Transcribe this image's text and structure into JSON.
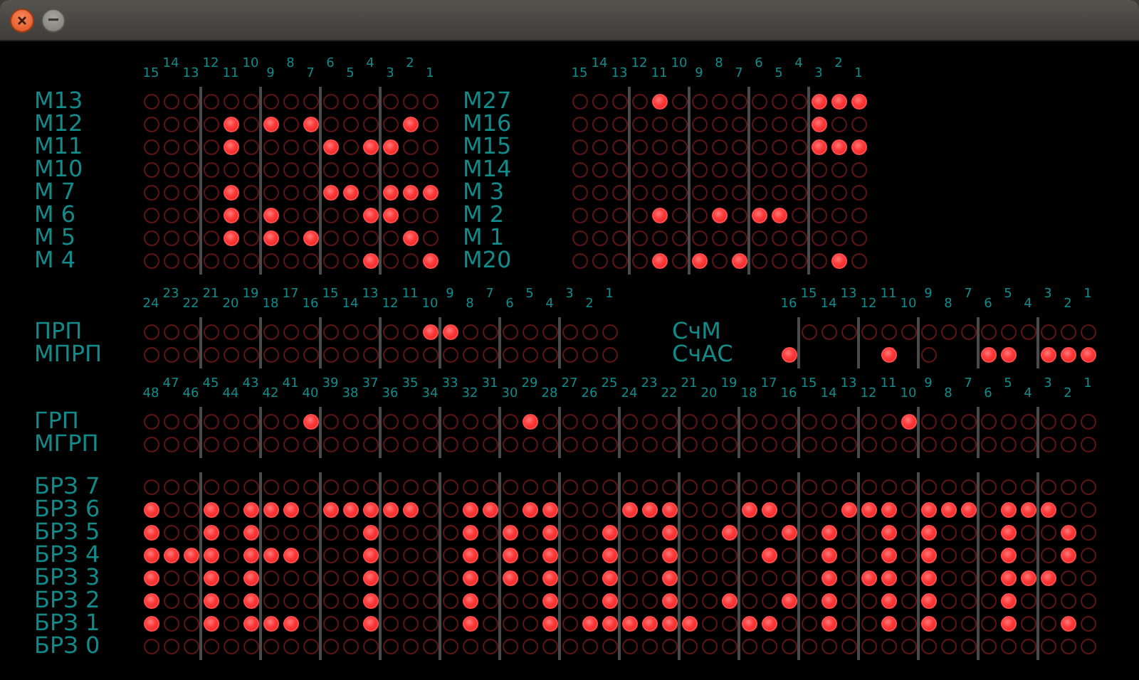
{
  "window": {
    "controls": [
      {
        "kind": "close"
      },
      {
        "kind": "minimize"
      }
    ]
  },
  "sections": [
    {
      "blocks": [
        {
          "numbers": [
            "15",
            "14",
            "13",
            "12",
            "11",
            "10",
            "9",
            "8",
            "7",
            "6",
            "5",
            "4",
            "3",
            "2",
            "1"
          ],
          "rows": [
            {
              "label": "М13",
              "lamps": [
                false,
                false,
                false,
                false,
                false,
                false,
                false,
                false,
                false,
                false,
                false,
                false,
                false,
                false,
                false
              ]
            },
            {
              "label": "М12",
              "lamps": [
                false,
                false,
                false,
                false,
                true,
                false,
                true,
                false,
                true,
                false,
                false,
                false,
                false,
                true,
                false
              ]
            },
            {
              "label": "М11",
              "lamps": [
                false,
                false,
                false,
                false,
                true,
                false,
                false,
                false,
                false,
                true,
                false,
                true,
                true,
                false,
                false
              ]
            },
            {
              "label": "М10",
              "lamps": [
                false,
                false,
                false,
                false,
                false,
                false,
                false,
                false,
                false,
                false,
                false,
                false,
                false,
                false,
                false
              ]
            },
            {
              "label": "М 7",
              "lamps": [
                false,
                false,
                false,
                false,
                true,
                false,
                false,
                false,
                false,
                true,
                true,
                false,
                true,
                true,
                true
              ]
            },
            {
              "label": "М 6",
              "lamps": [
                false,
                false,
                false,
                false,
                true,
                false,
                true,
                false,
                false,
                false,
                false,
                true,
                true,
                false,
                false
              ]
            },
            {
              "label": "М 5",
              "lamps": [
                false,
                false,
                false,
                false,
                true,
                false,
                true,
                false,
                true,
                false,
                false,
                false,
                false,
                true,
                false
              ]
            },
            {
              "label": "М 4",
              "lamps": [
                false,
                false,
                false,
                false,
                false,
                false,
                false,
                false,
                false,
                false,
                false,
                true,
                false,
                false,
                true
              ]
            }
          ]
        },
        {
          "numbers": [
            "15",
            "14",
            "13",
            "12",
            "11",
            "10",
            "9",
            "8",
            "7",
            "6",
            "5",
            "4",
            "3",
            "2",
            "1"
          ],
          "rows": [
            {
              "label": "М27",
              "lamps": [
                false,
                false,
                false,
                false,
                true,
                false,
                false,
                false,
                false,
                false,
                false,
                false,
                true,
                true,
                true
              ]
            },
            {
              "label": "М16",
              "lamps": [
                false,
                false,
                false,
                false,
                false,
                false,
                false,
                false,
                false,
                false,
                false,
                false,
                true,
                false,
                false
              ]
            },
            {
              "label": "М15",
              "lamps": [
                false,
                false,
                false,
                false,
                false,
                false,
                false,
                false,
                false,
                false,
                false,
                false,
                true,
                true,
                true
              ]
            },
            {
              "label": "М14",
              "lamps": [
                false,
                false,
                false,
                false,
                false,
                false,
                false,
                false,
                false,
                false,
                false,
                false,
                false,
                false,
                false
              ]
            },
            {
              "label": "М 3",
              "lamps": [
                false,
                false,
                false,
                false,
                false,
                false,
                false,
                false,
                false,
                false,
                false,
                false,
                false,
                false,
                false
              ]
            },
            {
              "label": "М 2",
              "lamps": [
                false,
                false,
                false,
                false,
                true,
                false,
                false,
                true,
                false,
                true,
                true,
                false,
                false,
                false,
                false
              ]
            },
            {
              "label": "М 1",
              "lamps": [
                false,
                false,
                false,
                false,
                false,
                false,
                false,
                false,
                false,
                false,
                false,
                false,
                false,
                false,
                false
              ]
            },
            {
              "label": "М20",
              "lamps": [
                false,
                false,
                false,
                false,
                true,
                false,
                true,
                false,
                true,
                false,
                false,
                false,
                false,
                true,
                false
              ]
            }
          ]
        }
      ]
    },
    {
      "blocks": [
        {
          "numbers": [
            "24",
            "23",
            "22",
            "21",
            "20",
            "19",
            "18",
            "17",
            "16",
            "15",
            "14",
            "13",
            "12",
            "11",
            "10",
            "9",
            "8",
            "7",
            "6",
            "5",
            "4",
            "3",
            "2",
            "1"
          ],
          "rows": [
            {
              "label": "ПРП",
              "lamps": [
                false,
                false,
                false,
                false,
                false,
                false,
                false,
                false,
                false,
                false,
                false,
                false,
                false,
                false,
                true,
                true,
                false,
                false,
                false,
                false,
                false,
                false,
                false,
                false
              ]
            },
            {
              "label": "МПРП",
              "lamps": [
                false,
                false,
                false,
                false,
                false,
                false,
                false,
                false,
                false,
                false,
                false,
                false,
                false,
                false,
                false,
                false,
                false,
                false,
                false,
                false,
                false,
                false,
                false,
                false
              ]
            }
          ]
        },
        {
          "numbers": [
            "16",
            "15",
            "14",
            "13",
            "12",
            "11",
            "10",
            "9",
            "8",
            "7",
            "6",
            "5",
            "4",
            "3",
            "2",
            "1"
          ],
          "rows": [
            {
              "label": "СчМ",
              "lamps": [
                {
                  "kind": "gap"
                },
                {
                  "kind": "lamp",
                  "on": false
                },
                {
                  "kind": "lamp",
                  "on": false
                },
                {
                  "kind": "lamp",
                  "on": false
                },
                {
                  "kind": "lamp",
                  "on": false
                },
                {
                  "kind": "lamp",
                  "on": false
                },
                {
                  "kind": "lamp",
                  "on": false
                },
                {
                  "kind": "lamp",
                  "on": false
                },
                {
                  "kind": "lamp",
                  "on": false
                },
                {
                  "kind": "lamp",
                  "on": false
                },
                {
                  "kind": "lamp",
                  "on": false
                },
                {
                  "kind": "lamp",
                  "on": false
                },
                {
                  "kind": "lamp",
                  "on": false
                },
                {
                  "kind": "lamp",
                  "on": false
                },
                {
                  "kind": "lamp",
                  "on": false
                },
                {
                  "kind": "lamp",
                  "on": false
                }
              ]
            },
            {
              "label": "СчАС",
              "lamps": [
                {
                  "kind": "lamp",
                  "on": true
                },
                {
                  "kind": "gap"
                },
                {
                  "kind": "gap"
                },
                {
                  "kind": "gap"
                },
                {
                  "kind": "gap"
                },
                {
                  "kind": "lamp",
                  "on": true
                },
                {
                  "kind": "gap"
                },
                {
                  "kind": "lamp",
                  "on": false
                },
                {
                  "kind": "gap"
                },
                {
                  "kind": "gap"
                },
                {
                  "kind": "lamp",
                  "on": true
                },
                {
                  "kind": "lamp",
                  "on": true
                },
                {
                  "kind": "gap"
                },
                {
                  "kind": "lamp",
                  "on": true
                },
                {
                  "kind": "lamp",
                  "on": true
                },
                {
                  "kind": "lamp",
                  "on": true
                }
              ]
            }
          ]
        }
      ]
    },
    {
      "blocks": [
        {
          "numbers": [
            "48",
            "47",
            "46",
            "45",
            "44",
            "43",
            "42",
            "41",
            "40",
            "39",
            "38",
            "37",
            "36",
            "35",
            "34",
            "33",
            "32",
            "31",
            "30",
            "29",
            "28",
            "27",
            "26",
            "25",
            "24",
            "23",
            "22",
            "21",
            "20",
            "19",
            "18",
            "17",
            "16",
            "15",
            "14",
            "13",
            "12",
            "11",
            "10",
            "9",
            "8",
            "7",
            "6",
            "5",
            "4",
            "3",
            "2",
            "1"
          ],
          "rows": [
            {
              "label": "ГРП",
              "lamps": [
                false,
                false,
                false,
                false,
                false,
                false,
                false,
                false,
                true,
                false,
                false,
                false,
                false,
                false,
                false,
                false,
                false,
                false,
                false,
                true,
                false,
                false,
                false,
                false,
                false,
                false,
                false,
                false,
                false,
                false,
                false,
                false,
                false,
                false,
                false,
                false,
                false,
                false,
                true,
                false,
                false,
                false,
                false,
                false,
                false,
                false,
                false,
                false
              ]
            },
            {
              "label": "МГРП",
              "lamps": [
                false,
                false,
                false,
                false,
                false,
                false,
                false,
                false,
                false,
                false,
                false,
                false,
                false,
                false,
                false,
                false,
                false,
                false,
                false,
                false,
                false,
                false,
                false,
                false,
                false,
                false,
                false,
                false,
                false,
                false,
                false,
                false,
                false,
                false,
                false,
                false,
                false,
                false,
                false,
                false,
                false,
                false,
                false,
                false,
                false,
                false,
                false,
                false
              ]
            }
          ]
        }
      ]
    },
    {
      "blocks": [
        {
          "rows": [
            {
              "label": "БРЗ 7",
              "lamps": [
                false,
                false,
                false,
                false,
                false,
                false,
                false,
                false,
                false,
                false,
                false,
                false,
                false,
                false,
                false,
                false,
                false,
                false,
                false,
                false,
                false,
                false,
                false,
                false,
                false,
                false,
                false,
                false,
                false,
                false,
                false,
                false,
                false,
                false,
                false,
                false,
                false,
                false,
                false,
                false,
                false,
                false,
                false,
                false,
                false,
                false,
                false,
                false
              ]
            },
            {
              "label": "БРЗ 6",
              "lamps": [
                true,
                false,
                false,
                true,
                false,
                true,
                true,
                true,
                false,
                true,
                true,
                true,
                true,
                true,
                false,
                false,
                true,
                true,
                false,
                true,
                true,
                false,
                false,
                false,
                true,
                true,
                true,
                false,
                false,
                false,
                true,
                true,
                false,
                false,
                false,
                true,
                true,
                true,
                false,
                true,
                true,
                true,
                false,
                true,
                true,
                true,
                false,
                false
              ]
            },
            {
              "label": "БРЗ 5",
              "lamps": [
                true,
                false,
                false,
                true,
                false,
                true,
                false,
                false,
                false,
                false,
                false,
                true,
                false,
                false,
                false,
                false,
                true,
                false,
                true,
                false,
                true,
                false,
                false,
                true,
                false,
                false,
                true,
                false,
                false,
                true,
                false,
                false,
                true,
                false,
                true,
                false,
                false,
                true,
                false,
                true,
                false,
                false,
                false,
                true,
                false,
                false,
                true,
                false
              ]
            },
            {
              "label": "БРЗ 4",
              "lamps": [
                true,
                true,
                true,
                true,
                false,
                true,
                true,
                true,
                false,
                false,
                false,
                true,
                false,
                false,
                false,
                false,
                true,
                false,
                true,
                false,
                true,
                false,
                false,
                true,
                false,
                false,
                true,
                false,
                false,
                false,
                false,
                true,
                false,
                false,
                true,
                false,
                false,
                true,
                false,
                true,
                false,
                false,
                false,
                true,
                false,
                false,
                true,
                false
              ]
            },
            {
              "label": "БРЗ 3",
              "lamps": [
                true,
                false,
                false,
                true,
                false,
                true,
                false,
                false,
                false,
                false,
                false,
                true,
                false,
                false,
                false,
                false,
                true,
                false,
                true,
                false,
                true,
                false,
                false,
                true,
                false,
                false,
                true,
                false,
                false,
                false,
                false,
                false,
                false,
                false,
                true,
                false,
                true,
                true,
                false,
                true,
                false,
                false,
                false,
                true,
                true,
                true,
                false,
                false
              ]
            },
            {
              "label": "БРЗ 2",
              "lamps": [
                true,
                false,
                false,
                true,
                false,
                true,
                false,
                false,
                false,
                false,
                false,
                true,
                false,
                false,
                false,
                false,
                true,
                false,
                false,
                false,
                true,
                false,
                false,
                true,
                false,
                false,
                true,
                false,
                false,
                true,
                false,
                false,
                true,
                false,
                true,
                false,
                false,
                true,
                false,
                true,
                false,
                false,
                false,
                true,
                false,
                false,
                false,
                false
              ]
            },
            {
              "label": "БРЗ 1",
              "lamps": [
                true,
                false,
                false,
                true,
                false,
                true,
                true,
                true,
                false,
                false,
                false,
                true,
                false,
                false,
                false,
                false,
                true,
                false,
                false,
                false,
                true,
                false,
                true,
                true,
                true,
                true,
                true,
                true,
                false,
                false,
                true,
                true,
                false,
                false,
                true,
                false,
                false,
                true,
                false,
                true,
                false,
                false,
                false,
                true,
                false,
                false,
                true,
                false
              ]
            },
            {
              "label": "БРЗ 0",
              "lamps": [
                false,
                false,
                false,
                false,
                false,
                false,
                false,
                false,
                false,
                false,
                false,
                false,
                false,
                false,
                false,
                false,
                false,
                false,
                false,
                false,
                false,
                false,
                false,
                false,
                false,
                false,
                false,
                false,
                false,
                false,
                false,
                false,
                false,
                false,
                false,
                false,
                false,
                false,
                false,
                false,
                false,
                false,
                false,
                false,
                false,
                false,
                false,
                false
              ]
            }
          ]
        }
      ]
    }
  ]
}
